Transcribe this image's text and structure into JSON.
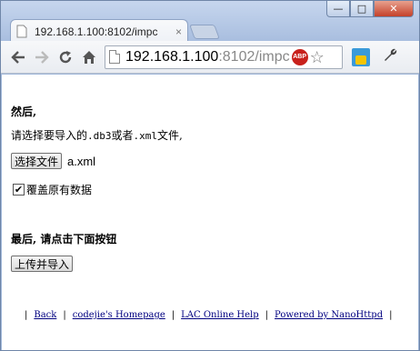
{
  "browser": {
    "tab_title": "192.168.1.100:8102/impc",
    "tab_close": "×",
    "address_host": "192.168.1.100",
    "address_rest": ":8102/impc",
    "abp_label": "ABP",
    "icons": {
      "back": "back-arrow-icon",
      "forward": "forward-arrow-icon",
      "reload": "reload-icon",
      "home": "home-icon",
      "bookmark": "star-icon",
      "menu": "wrench-icon"
    },
    "window_buttons": {
      "minimize": "—",
      "maximize": "□",
      "close": "✕"
    }
  },
  "page": {
    "heading_then": "然后,",
    "instruction_prefix": "请选择要导入的",
    "ext_db3": ".db3",
    "instruction_or": "或者",
    "ext_xml": ".xml",
    "instruction_suffix": "文件,",
    "choose_file_label": "选择文件",
    "selected_file": "a.xml",
    "overwrite_checked": "✔",
    "overwrite_label": "覆盖原有数据",
    "heading_finally": "最后, 请点击下面按钮",
    "upload_button": "上传并导入"
  },
  "footer": {
    "separator": "|",
    "links": [
      "Back",
      "codejie's Homepage",
      "LAC Online Help",
      "Powered by NanoHttpd"
    ]
  },
  "colors": {
    "link": "#000080",
    "frame": "#9fb6d9",
    "close_button": "#c4412a"
  }
}
